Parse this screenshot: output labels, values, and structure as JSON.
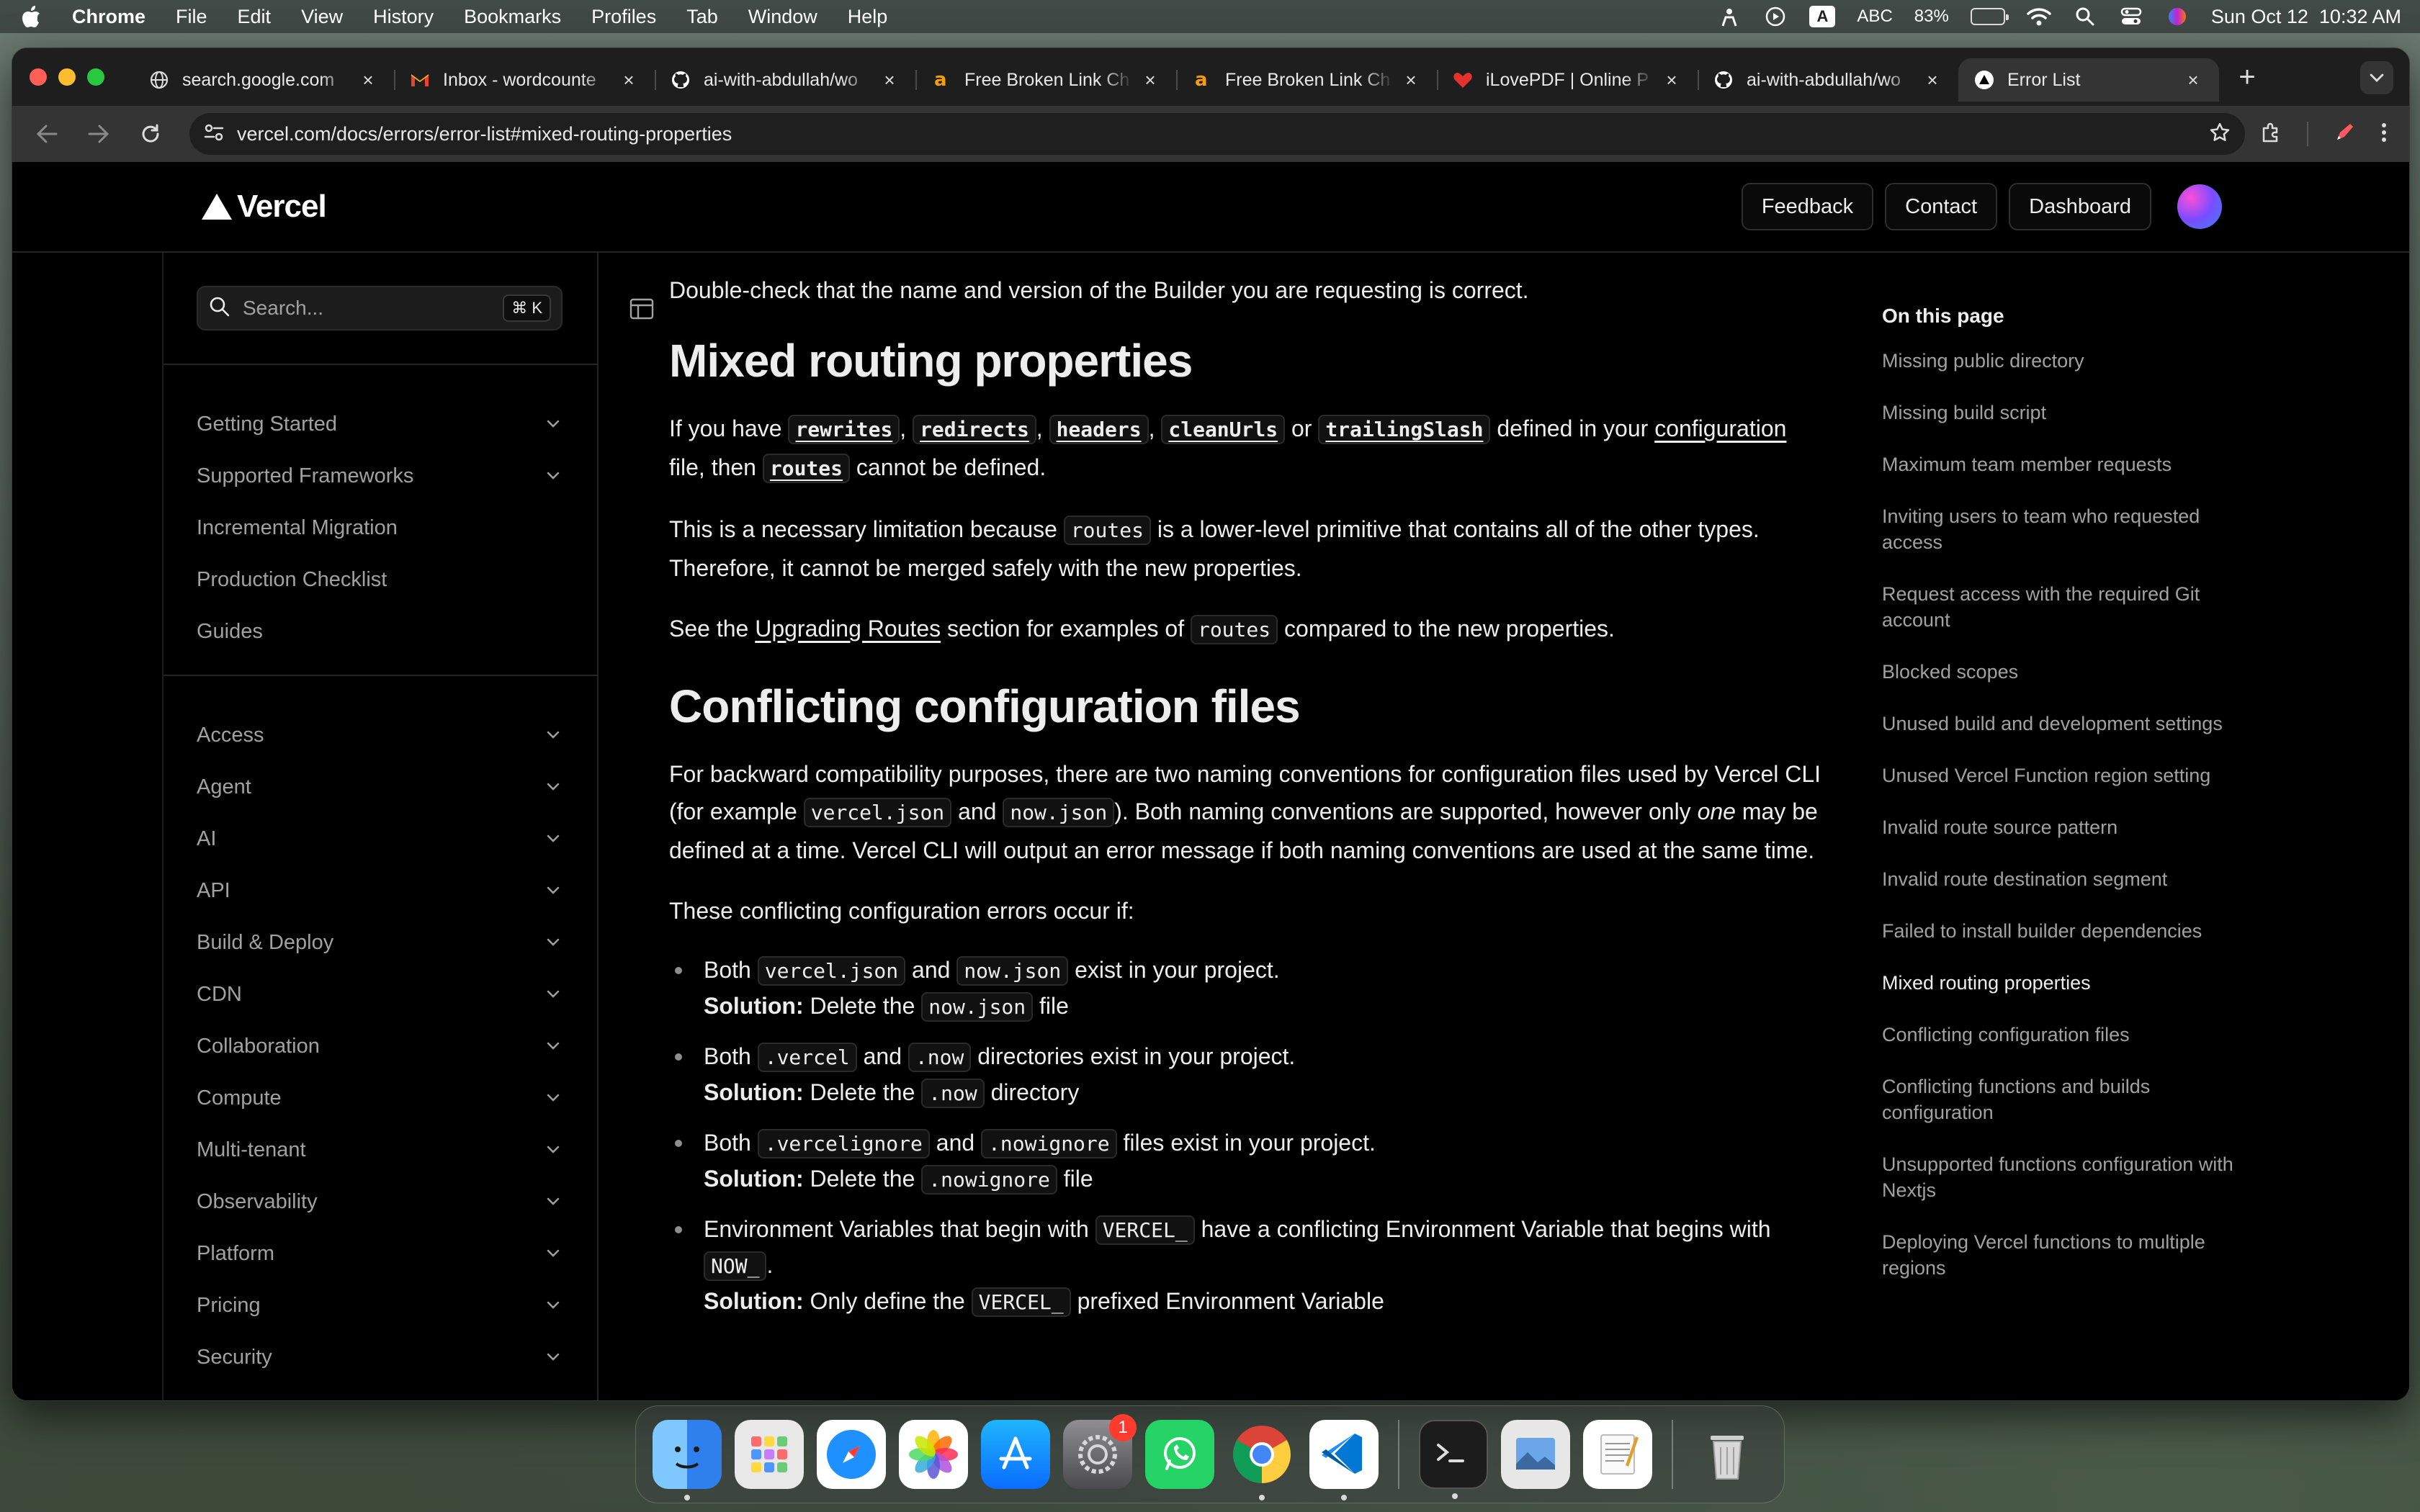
{
  "menubar": {
    "app": "Chrome",
    "items": [
      "File",
      "Edit",
      "View",
      "History",
      "Bookmarks",
      "Profiles",
      "Tab",
      "Window",
      "Help"
    ],
    "input_source": "A",
    "input_label": "ABC",
    "battery": "83%",
    "battery_level": 0.83,
    "datetime": "Sun Oct 12  10:32 AM"
  },
  "tabs": [
    {
      "title": "search.google.com",
      "icon": "globe-icon"
    },
    {
      "title": "Inbox - wordcounte",
      "icon": "gmail-icon"
    },
    {
      "title": "ai-with-abdullah/wo",
      "icon": "github-icon"
    },
    {
      "title": "Free Broken Link Ch",
      "icon": "a-icon"
    },
    {
      "title": "Free Broken Link Ch",
      "icon": "a-icon"
    },
    {
      "title": "iLovePDF | Online P",
      "icon": "heart-icon"
    },
    {
      "title": "ai-with-abdullah/wo",
      "icon": "github-icon"
    },
    {
      "title": "Error List",
      "icon": "vercel-icon",
      "active": true
    }
  ],
  "address": {
    "url": "vercel.com/docs/errors/error-list#mixed-routing-properties"
  },
  "header": {
    "logo": "Vercel",
    "feedback": "Feedback",
    "contact": "Contact",
    "dashboard": "Dashboard"
  },
  "search": {
    "placeholder": "Search...",
    "shortcut": "⌘ K"
  },
  "sidebar": {
    "group1": [
      {
        "label": "Getting Started",
        "expandable": true
      },
      {
        "label": "Supported Frameworks",
        "expandable": true
      },
      {
        "label": "Incremental Migration",
        "expandable": false
      },
      {
        "label": "Production Checklist",
        "expandable": false
      },
      {
        "label": "Guides",
        "expandable": false
      }
    ],
    "group2": [
      {
        "label": "Access"
      },
      {
        "label": "Agent"
      },
      {
        "label": "AI"
      },
      {
        "label": "API"
      },
      {
        "label": "Build & Deploy"
      },
      {
        "label": "CDN"
      },
      {
        "label": "Collaboration"
      },
      {
        "label": "Compute"
      },
      {
        "label": "Multi-tenant"
      },
      {
        "label": "Observability"
      },
      {
        "label": "Platform"
      },
      {
        "label": "Pricing"
      },
      {
        "label": "Security"
      }
    ]
  },
  "content": {
    "intro": "Double-check that the name and version of the Builder you are requesting is correct.",
    "h_mixed": "Mixed routing properties",
    "mixed_p1": {
      "t1": "If you have ",
      "c1": "rewrites",
      "s1": ", ",
      "c2": "redirects",
      "s2": ", ",
      "c3": "headers",
      "s3": ", ",
      "c4": "cleanUrls",
      "s4": " or ",
      "c5": "trailingSlash",
      "s5": " defined in your ",
      "link": "configuration",
      "t2": " file, then ",
      "c6": "routes",
      "t3": " cannot be defined."
    },
    "mixed_p2": {
      "t1": "This is a necessary limitation because ",
      "c1": "routes",
      "t2": " is a lower-level primitive that contains all of the other types. Therefore, it cannot be merged safely with the new properties."
    },
    "mixed_p3": {
      "t1": "See the ",
      "link": "Upgrading Routes",
      "t2": " section for examples of ",
      "c1": "routes",
      "t3": " compared to the new properties."
    },
    "h_conflict": "Conflicting configuration files",
    "conflict_p1": {
      "t1": "For backward compatibility purposes, there are two naming conventions for configuration files used by Vercel CLI (for example ",
      "c1": "vercel.json",
      "t2": " and ",
      "c2": "now.json",
      "t3": "). Both naming conventions are supported, however only ",
      "em": "one",
      "t4": " may be defined at a time. Vercel CLI will output an error message if both naming conventions are used at the same time."
    },
    "conflict_p2": "These conflicting configuration errors occur if:",
    "solution_label": "Solution:",
    "bullets": [
      {
        "t1": "Both ",
        "c1": "vercel.json",
        "t2": " and ",
        "c2": "now.json",
        "t3": " exist in your project.",
        "sol1": " Delete the ",
        "sc": "now.json",
        "sol2": " file"
      },
      {
        "t1": "Both ",
        "c1": ".vercel",
        "t2": " and ",
        "c2": ".now",
        "t3": " directories exist in your project.",
        "sol1": " Delete the ",
        "sc": ".now",
        "sol2": " directory"
      },
      {
        "t1": "Both ",
        "c1": ".vercelignore",
        "t2": " and ",
        "c2": ".nowignore",
        "t3": " files exist in your project.",
        "sol1": " Delete the ",
        "sc": ".nowignore",
        "sol2": " file"
      }
    ],
    "bullet_env": {
      "t1": "Environment Variables that begin with ",
      "c1": "VERCEL_",
      "t2": " have a conflicting Environment Variable that begins with ",
      "c2": "NOW_",
      "t3": ".",
      "sol1": " Only define the ",
      "sc": "VERCEL_",
      "sol2": " prefixed Environment Variable"
    }
  },
  "toc": {
    "title": "On this page",
    "items": [
      "Missing public directory",
      "Missing build script",
      "Maximum team member requests",
      "Inviting users to team who requested access",
      "Request access with the required Git account",
      "Blocked scopes",
      "Unused build and development settings",
      "Unused Vercel Function region setting",
      "Invalid route source pattern",
      "Invalid route destination segment",
      "Failed to install builder dependencies",
      "Mixed routing properties",
      "Conflicting configuration files",
      "Conflicting functions and builds configuration",
      "Unsupported functions configuration with Nextjs",
      "Deploying Vercel functions to multiple regions"
    ],
    "active_index": 11
  },
  "dock": {
    "apps": [
      "finder-icon",
      "launchpad-icon",
      "safari-icon",
      "photos-icon",
      "app-store-icon",
      "system-settings-icon",
      "whatsapp-icon",
      "chrome-icon",
      "vscode-icon",
      "terminal-icon",
      "preview-icon",
      "textedit-icon",
      "trash-icon"
    ],
    "settings_badge": "1"
  }
}
